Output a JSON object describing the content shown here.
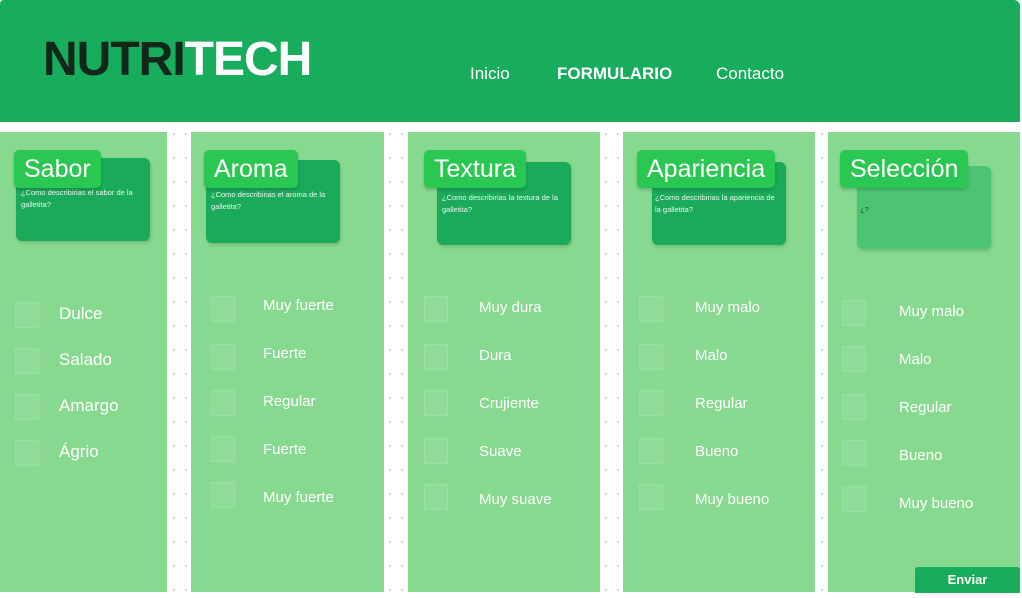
{
  "header": {
    "logo_part1": "NUTRI",
    "logo_part2": "TECH",
    "nav": [
      "Inicio",
      "FORMULARIO",
      "Contacto"
    ]
  },
  "columns": [
    {
      "title": "Sabor",
      "question": "¿Como describirias el sabor de la galletita?",
      "options": [
        "Dulce",
        "Salado",
        "Amargo",
        "Ágrio"
      ]
    },
    {
      "title": "Aroma",
      "question": "¿Como describirias el aroma de la galletita?",
      "options": [
        "Muy fuerte",
        "Fuerte",
        "Regular",
        "Fuerte",
        "Muy fuerte"
      ]
    },
    {
      "title": "Textura",
      "question": "¿Como describirias la textura de la galletita?",
      "options": [
        "Muy dura",
        "Dura",
        "Crujiente",
        "Suave",
        "Muy suave"
      ]
    },
    {
      "title": "Apariencia",
      "question": "¿Como describirias la apariencia de la galletita?",
      "options": [
        "Muy malo",
        "Malo",
        "Regular",
        "Bueno",
        "Muy bueno"
      ]
    },
    {
      "title": "Selección",
      "question": "¿?",
      "options": [
        "Muy malo",
        "Malo",
        "Regular",
        "Bueno",
        "Muy bueno"
      ]
    }
  ],
  "submit_label": "Enviar",
  "colors": {
    "header": "#17ad5c",
    "panel": "#86d98f",
    "tag": "#2bc753",
    "card": "#1ba95a"
  }
}
